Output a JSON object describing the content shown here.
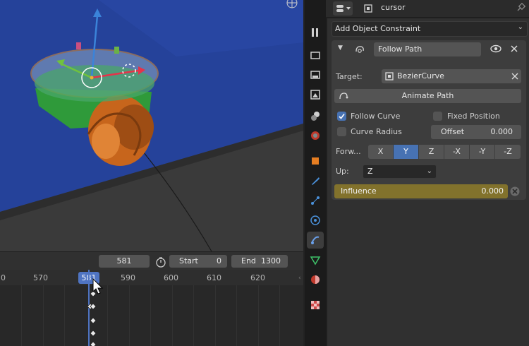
{
  "viewport": {
    "gizmo_icon": "grid-icon"
  },
  "timeline": {
    "current_frame": "581",
    "start_label": "Start",
    "start_value": "0",
    "end_label": "End",
    "end_value": "1300",
    "ruler_labels": [
      "0",
      "570",
      "581",
      "590",
      "600",
      "610",
      "620"
    ],
    "playhead_label": "581"
  },
  "properties": {
    "object_name": "cursor",
    "add_constraint": "Add Object Constraint",
    "constraint": {
      "name": "Follow Path",
      "target_label": "Target:",
      "target_value": "BezierCurve",
      "animate_path": "Animate Path",
      "follow_curve": "Follow Curve",
      "follow_curve_checked": true,
      "fixed_position": "Fixed Position",
      "fixed_position_checked": false,
      "curve_radius": "Curve Radius",
      "curve_radius_checked": false,
      "offset_label": "Offset",
      "offset_value": "0.000",
      "forward_label": "Forw...",
      "forward_axes": [
        "X",
        "Y",
        "Z",
        "-X",
        "-Y",
        "-Z"
      ],
      "forward_selected": "Y",
      "up_label": "Up:",
      "up_value": "Z",
      "influence_label": "Influence",
      "influence_value": "0.000"
    }
  },
  "colors": {
    "accent": "#4772b3",
    "influence": "#82722c",
    "panel": "#3d3d3d"
  }
}
